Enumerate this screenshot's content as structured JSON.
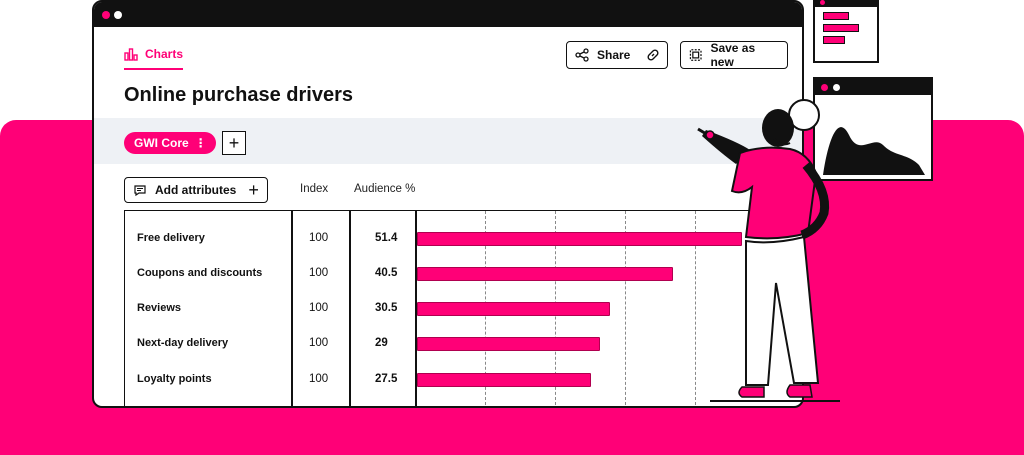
{
  "header": {
    "tab_label": "Charts",
    "share_label": "Share",
    "save_label": "Save as new"
  },
  "page": {
    "title": "Online purchase drivers"
  },
  "filter": {
    "chip_label": "GWI Core",
    "add_symbol": "+"
  },
  "table": {
    "add_attributes_label": "Add attributes",
    "columns": {
      "index": "Index",
      "audience": "Audience %"
    },
    "rows": [
      {
        "label": "Free delivery",
        "index": "100",
        "audience": "51.4"
      },
      {
        "label": "Coupons and discounts",
        "index": "100",
        "audience": "40.5"
      },
      {
        "label": "Reviews",
        "index": "100",
        "audience": "30.5"
      },
      {
        "label": "Next-day delivery",
        "index": "100",
        "audience": "29"
      },
      {
        "label": "Loyalty points",
        "index": "100",
        "audience": "27.5"
      }
    ]
  },
  "colors": {
    "accent": "#ff0077",
    "ink": "#111111",
    "filter_bg": "#eef1f5"
  },
  "icons": [
    "chart-bar-icon",
    "share-icon",
    "link-icon",
    "save-copy-icon",
    "comment-icon",
    "plus-icon",
    "kebab-icon"
  ]
}
